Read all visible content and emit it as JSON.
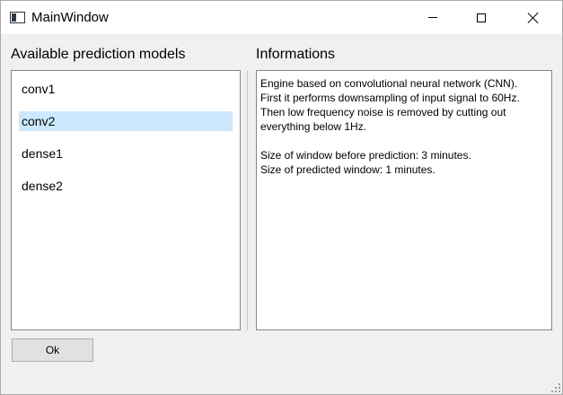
{
  "window": {
    "title": "MainWindow"
  },
  "models_panel": {
    "label": "Available prediction models",
    "items": [
      {
        "label": "conv1",
        "selected": false
      },
      {
        "label": "conv2",
        "selected": true
      },
      {
        "label": "dense1",
        "selected": false
      },
      {
        "label": "dense2",
        "selected": false
      }
    ]
  },
  "info_panel": {
    "label": "Informations",
    "lines": [
      "Engine based on convolutional neural network (CNN).",
      "First it performs downsampling of input signal to 60Hz.",
      "Then low frequency noise is removed by cutting out",
      "everything below 1Hz.",
      "",
      "Size of window before prediction: 3 minutes.",
      "Size of predicted window: 1 minutes."
    ]
  },
  "buttons": {
    "ok_label": "Ok"
  },
  "colors": {
    "selection": "#cce8ff",
    "window_bg": "#f0f0f0"
  },
  "icons": [
    "app-icon",
    "minimize-icon",
    "maximize-icon",
    "close-icon",
    "size-grip-icon"
  ]
}
